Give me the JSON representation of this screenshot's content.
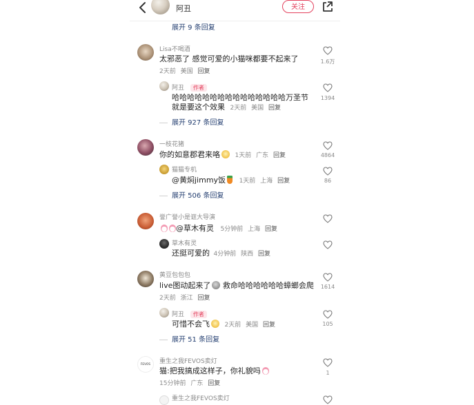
{
  "header": {
    "username": "阿丑",
    "follow_label": "关注",
    "icons": {
      "back": "chevron-left-icon",
      "share": "share-icon"
    }
  },
  "top_expand": "展开 9 条回复",
  "comments": [
    {
      "user": "Lisa不喝酒",
      "text": "太邪恶了 感觉可爱的小猫咪都要不起来了",
      "time": "2天前",
      "location": "美国",
      "reply_label": "回复",
      "likes": "1.6万",
      "replies": [
        {
          "user": "阿丑",
          "tag": "作者",
          "text_line1": "哈哈哈哈哈哈哈哈哈哈哈哈哈哈哈万圣节",
          "text_line2": "就是要这个效果",
          "time": "2天前",
          "location": "美国",
          "reply_label": "回复",
          "likes": "1394"
        }
      ],
      "expand": "展开 927 条回复"
    },
    {
      "user": "一枝花猪",
      "text": "你的如意郡君来咯",
      "time": "1天前",
      "location": "广东",
      "reply_label": "回复",
      "likes": "4864",
      "replies": [
        {
          "user": "猫猫专机",
          "text": "@黄焖jimmy饭",
          "time": "1天前",
          "location": "上海",
          "reply_label": "回复",
          "likes": "86"
        }
      ],
      "expand": "展开 506 条回复"
    },
    {
      "user": "誉广誉小是诓大导演",
      "text": "@草木有灵",
      "time": "5分钟前",
      "location": "上海",
      "reply_label": "回复",
      "likes": "",
      "replies": [
        {
          "user": "草木有灵",
          "text": "还挺可爱的",
          "time": "4分钟前",
          "location": "陕西",
          "reply_label": "回复",
          "likes": ""
        }
      ]
    },
    {
      "user": "黄豆包包包",
      "text_a": "live图动起来了",
      "text_b": "救命哈哈哈哈哈哈蟑螂会爬",
      "time": "2天前",
      "location": "浙江",
      "reply_label": "回复",
      "likes": "1614",
      "replies": [
        {
          "user": "阿丑",
          "tag": "作者",
          "text": "可惜不会飞",
          "time": "2天前",
          "location": "美国",
          "reply_label": "回复",
          "likes": "105"
        }
      ],
      "expand": "展开 51 条回复"
    },
    {
      "user": "重生之我FEVOS卖灯",
      "avatar_text": "FEVOS",
      "text": "猫:把我搞成这样子，你礼貌吗",
      "time": "15分钟前",
      "location": "广东",
      "reply_label": "回复",
      "likes": "1"
    },
    {
      "user": "重生之我FEVOS卖灯"
    }
  ],
  "colors": {
    "accent": "#e3415d",
    "link": "#233e70",
    "muted": "#8a8a8a"
  }
}
